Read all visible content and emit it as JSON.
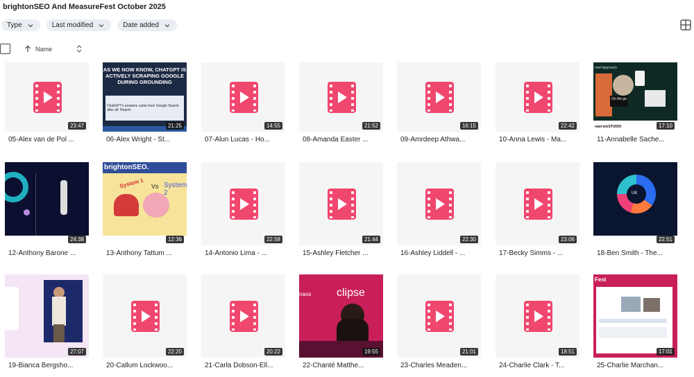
{
  "title": "brightonSEO And MeasureFest October 2025",
  "filters": [
    {
      "label": "Type"
    },
    {
      "label": "Last modified"
    },
    {
      "label": "Date added"
    }
  ],
  "list_header": {
    "name_label": "Name"
  },
  "colors": {
    "accent": "#f0476f",
    "chip_bg": "#eaeef3",
    "thumb_bg": "#f5f5f5"
  },
  "thumbs": {
    "t06": {
      "line1": "AS WE NOW KNOW, CHATGPT IS",
      "line2": "ACTIVELY SCRAPING GOOGLE",
      "line3": "DURING GROUNDING",
      "caption": "ChatGPT's answers came from Google Search after all: Report"
    },
    "t11": {
      "header": "nnel Approach",
      "badge": "On the go",
      "sponsors": "rawl  wixSTUDIO"
    },
    "t13": {
      "brand": "brightonSEO.",
      "vs": "Vs",
      "sys1": "System 1",
      "sys2": "System 2"
    },
    "t18": {
      "center": "UK"
    },
    "t22": {
      "brand": "clipse",
      "left": "naos"
    },
    "t25": {
      "brand": "Fest"
    }
  },
  "files": [
    {
      "name": "05-Alex van de Pol ...",
      "duration": "23:47",
      "icon": "video-file-icon"
    },
    {
      "name": "06-Alex Wright - St...",
      "duration": "21:25",
      "icon": "thumbnail"
    },
    {
      "name": "07-Alun Lucas - Ho...",
      "duration": "14:55",
      "icon": "video-file-icon"
    },
    {
      "name": "08-Amanda Easter ...",
      "duration": "21:52",
      "icon": "video-file-icon"
    },
    {
      "name": "09-Amrdeep Athwa...",
      "duration": "16:15",
      "icon": "video-file-icon"
    },
    {
      "name": "10-Anna Lewis - Ma...",
      "duration": "22:42",
      "icon": "video-file-icon"
    },
    {
      "name": "11-Annabelle Sache...",
      "duration": "17:10",
      "icon": "thumbnail"
    },
    {
      "name": "12-Anthony Barone ...",
      "duration": "24:38",
      "icon": "thumbnail"
    },
    {
      "name": "13-Anthony Tattum ...",
      "duration": "12:36",
      "icon": "thumbnail"
    },
    {
      "name": "14-Antonio Lima - ...",
      "duration": "22:58",
      "icon": "video-file-icon"
    },
    {
      "name": "15-Ashley Fletcher ...",
      "duration": "21:44",
      "icon": "video-file-icon"
    },
    {
      "name": "16-Ashley Liddell - ...",
      "duration": "22:30",
      "icon": "video-file-icon"
    },
    {
      "name": "17-Becky Simms - ...",
      "duration": "23:06",
      "icon": "video-file-icon"
    },
    {
      "name": "18-Ben Smith - The...",
      "duration": "22:51",
      "icon": "thumbnail"
    },
    {
      "name": "19-Bianca Bergsho...",
      "duration": "27:07",
      "icon": "thumbnail"
    },
    {
      "name": "20-Callum Lockwoo...",
      "duration": "22:20",
      "icon": "video-file-icon"
    },
    {
      "name": "21-Carla Dobson-Ell...",
      "duration": "20:22",
      "icon": "video-file-icon"
    },
    {
      "name": "22-Chanté Matthe...",
      "duration": "19:55",
      "icon": "thumbnail"
    },
    {
      "name": "23-Charles Meaden...",
      "duration": "21:01",
      "icon": "video-file-icon"
    },
    {
      "name": "24-Charlie Clark - T...",
      "duration": "18:51",
      "icon": "video-file-icon"
    },
    {
      "name": "25-Charlie Marchan...",
      "duration": "17:01",
      "icon": "thumbnail"
    }
  ]
}
